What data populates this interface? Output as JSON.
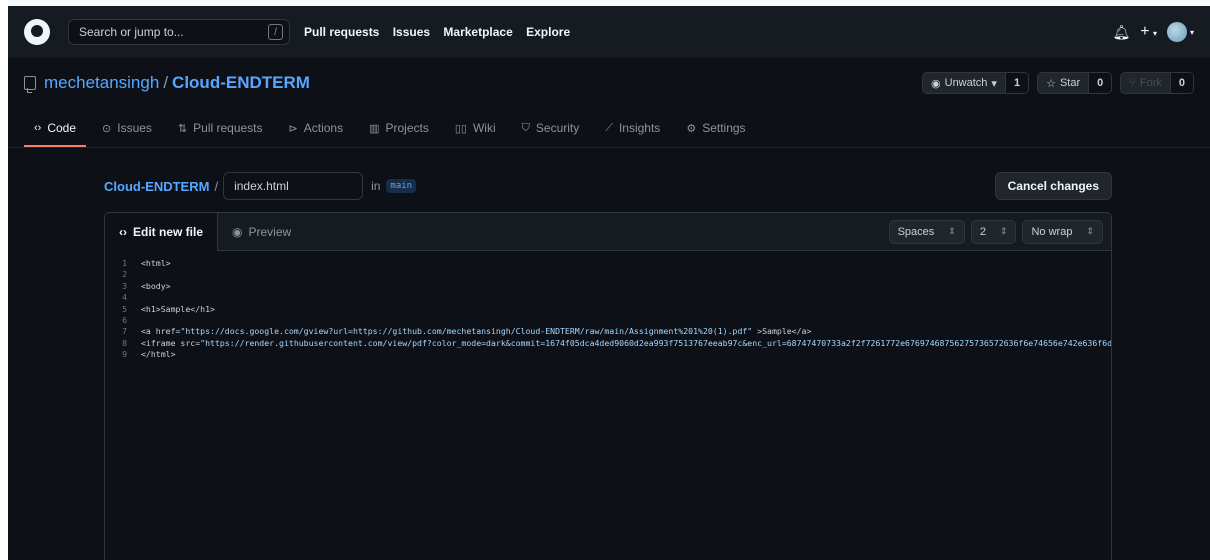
{
  "header": {
    "search_placeholder": "Search or jump to...",
    "search_key": "/",
    "nav": [
      "Pull requests",
      "Issues",
      "Marketplace",
      "Explore"
    ],
    "icons": [
      "github-logo-icon",
      "bell-icon",
      "plus-icon",
      "avatar"
    ]
  },
  "repo": {
    "owner": "mechetansingh",
    "separator": "/",
    "name": "Cloud-ENDTERM",
    "watch_label": "Unwatch",
    "watch_count": "1",
    "star_label": "Star",
    "star_count": "0",
    "fork_label": "Fork",
    "fork_count": "0"
  },
  "tabs": [
    {
      "label": "Code",
      "icon": "code-icon",
      "active": true
    },
    {
      "label": "Issues",
      "icon": "issue-icon"
    },
    {
      "label": "Pull requests",
      "icon": "pull-request-icon"
    },
    {
      "label": "Actions",
      "icon": "play-icon"
    },
    {
      "label": "Projects",
      "icon": "project-icon"
    },
    {
      "label": "Wiki",
      "icon": "book-icon"
    },
    {
      "label": "Security",
      "icon": "shield-icon"
    },
    {
      "label": "Insights",
      "icon": "graph-icon"
    },
    {
      "label": "Settings",
      "icon": "gear-icon"
    }
  ],
  "edit": {
    "crumb_repo": "Cloud-ENDTERM",
    "crumb_sep": "/",
    "filename": "index.html",
    "in_label": "in",
    "branch": "main",
    "cancel_label": "Cancel changes",
    "edit_tab": "Edit new file",
    "preview_tab": "Preview",
    "indent_mode": "Spaces",
    "indent_size": "2",
    "wrap_mode": "No wrap"
  },
  "code_lines": [
    {
      "n": "1",
      "text": "<html>"
    },
    {
      "n": "2",
      "text": ""
    },
    {
      "n": "3",
      "text": "<body>"
    },
    {
      "n": "4",
      "text": ""
    },
    {
      "n": "5",
      "text": "<h1>Sample</h1>"
    },
    {
      "n": "6",
      "text": ""
    },
    {
      "n": "7",
      "pre": "<a href=",
      "str": "\"https://docs.google.com/gview?url=https://github.com/mechetansingh/Cloud-ENDTERM/raw/main/Assignment%201%20(1).pdf\"",
      "post": " >Sample</a>"
    },
    {
      "n": "8",
      "pre": "<iframe src=",
      "str": "\"https://render.githubusercontent.com/view/pdf?color_mode=dark&commit=1674f05dca4ded9060d2ea993f7513767eeab97c&enc_url=68747470733a2f2f7261772e67697468756275736572636f6e74656e742e636f6d2f6",
      "post": ""
    },
    {
      "n": "9",
      "text": "</html>"
    }
  ]
}
